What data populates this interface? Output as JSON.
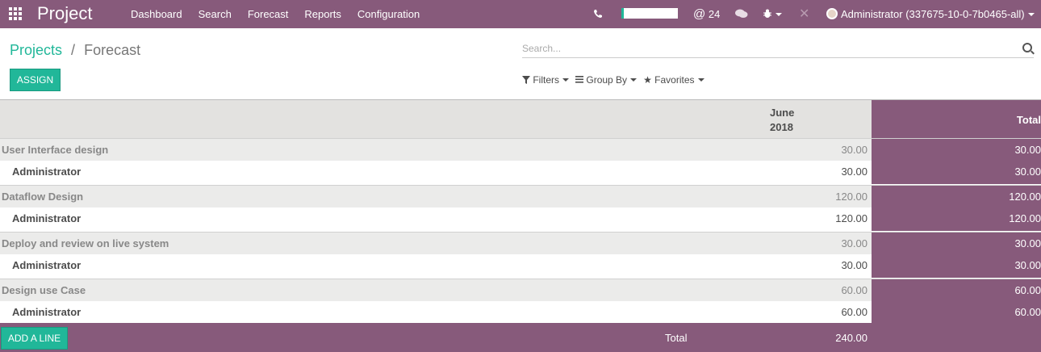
{
  "nav": {
    "brand": "Project",
    "menu": [
      "Dashboard",
      "Search",
      "Forecast",
      "Reports",
      "Configuration"
    ],
    "mentions": "24",
    "user": "Administrator (337675-10-0-7b0465-all)"
  },
  "breadcrumb": {
    "parent": "Projects",
    "separator": "/",
    "current": "Forecast"
  },
  "actions": {
    "assign": "ASSIGN",
    "add_line": "ADD A LINE"
  },
  "search": {
    "placeholder": "Search..."
  },
  "filters": {
    "filters": "Filters",
    "group_by": "Group By",
    "favorites": "Favorites"
  },
  "grid": {
    "month": "June 2018",
    "total_header": "Total",
    "rows": [
      {
        "project": "User Interface design",
        "project_value": "30.00",
        "project_total": "30.00",
        "user": "Administrator",
        "user_value": "30.00",
        "user_total": "30.00"
      },
      {
        "project": "Dataflow Design",
        "project_value": "120.00",
        "project_total": "120.00",
        "user": "Administrator",
        "user_value": "120.00",
        "user_total": "120.00"
      },
      {
        "project": "Deploy and review on live system",
        "project_value": "30.00",
        "project_total": "30.00",
        "user": "Administrator",
        "user_value": "30.00",
        "user_total": "30.00"
      },
      {
        "project": "Design use Case",
        "project_value": "60.00",
        "project_total": "60.00",
        "user": "Administrator",
        "user_value": "60.00",
        "user_total": "60.00"
      }
    ],
    "footer_label": "Total",
    "footer_value": "240.00"
  }
}
